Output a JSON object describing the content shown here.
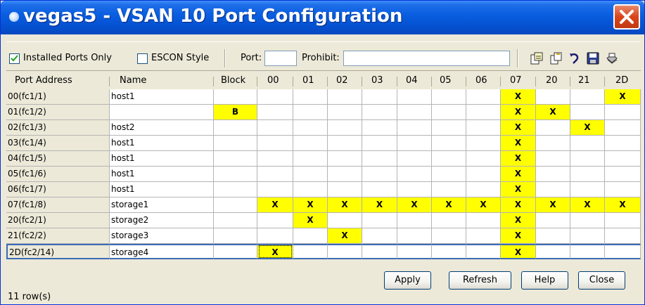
{
  "window": {
    "title": "vegas5 - VSAN 10 Port Configuration"
  },
  "toolbar": {
    "installed_ports_only": {
      "label": "Installed Ports Only",
      "checked": true
    },
    "escon_style": {
      "label": "ESCON Style",
      "checked": false
    },
    "port_label": "Port:",
    "port_value": "",
    "prohibit_label": "Prohibit:",
    "prohibit_value": "",
    "icons": [
      "export-icon",
      "copy-icon",
      "undo-icon",
      "save-icon",
      "print-icon"
    ]
  },
  "table": {
    "columns": [
      "Port Address",
      "Name",
      "Block",
      "00",
      "01",
      "02",
      "03",
      "04",
      "05",
      "06",
      "07",
      "20",
      "21",
      "2D"
    ],
    "rows": [
      {
        "addr": "00(fc1/1)",
        "name": "host1",
        "block": "",
        "marks": [
          "",
          "",
          "",
          "",
          "",
          "",
          "",
          "X",
          "",
          "",
          "X"
        ]
      },
      {
        "addr": "01(fc1/2)",
        "name": "",
        "block": "B",
        "marks": [
          "",
          "",
          "",
          "",
          "",
          "",
          "",
          "X",
          "X",
          "",
          ""
        ]
      },
      {
        "addr": "02(fc1/3)",
        "name": "host2",
        "block": "",
        "marks": [
          "",
          "",
          "",
          "",
          "",
          "",
          "",
          "X",
          "",
          "X",
          ""
        ]
      },
      {
        "addr": "03(fc1/4)",
        "name": "host1",
        "block": "",
        "marks": [
          "",
          "",
          "",
          "",
          "",
          "",
          "",
          "X",
          "",
          "",
          ""
        ]
      },
      {
        "addr": "04(fc1/5)",
        "name": "host1",
        "block": "",
        "marks": [
          "",
          "",
          "",
          "",
          "",
          "",
          "",
          "X",
          "",
          "",
          ""
        ]
      },
      {
        "addr": "05(fc1/6)",
        "name": "host1",
        "block": "",
        "marks": [
          "",
          "",
          "",
          "",
          "",
          "",
          "",
          "X",
          "",
          "",
          ""
        ]
      },
      {
        "addr": "06(fc1/7)",
        "name": "host1",
        "block": "",
        "marks": [
          "",
          "",
          "",
          "",
          "",
          "",
          "",
          "X",
          "",
          "",
          ""
        ]
      },
      {
        "addr": "07(fc1/8)",
        "name": "storage1",
        "block": "",
        "marks": [
          "X",
          "X",
          "X",
          "X",
          "X",
          "X",
          "X",
          "X",
          "X",
          "X",
          "X"
        ]
      },
      {
        "addr": "20(fc2/1)",
        "name": "storage2",
        "block": "",
        "marks": [
          "",
          "X",
          "",
          "",
          "",
          "",
          "",
          "X",
          "",
          "",
          ""
        ]
      },
      {
        "addr": "21(fc2/2)",
        "name": "storage3",
        "block": "",
        "marks": [
          "",
          "",
          "X",
          "",
          "",
          "",
          "",
          "X",
          "",
          "",
          ""
        ]
      },
      {
        "addr": "2D(fc2/14)",
        "name": "storage4",
        "block": "",
        "marks": [
          "X",
          "",
          "",
          "",
          "",
          "",
          "",
          "X",
          "",
          "",
          ""
        ]
      }
    ],
    "selected_row": 10,
    "highlight_color": "#ffff00",
    "selection_color": "#3b6bb5"
  },
  "buttons": {
    "apply": "Apply",
    "refresh": "Refresh",
    "help": "Help",
    "close": "Close"
  },
  "status": {
    "row_count": "11 row(s)"
  }
}
